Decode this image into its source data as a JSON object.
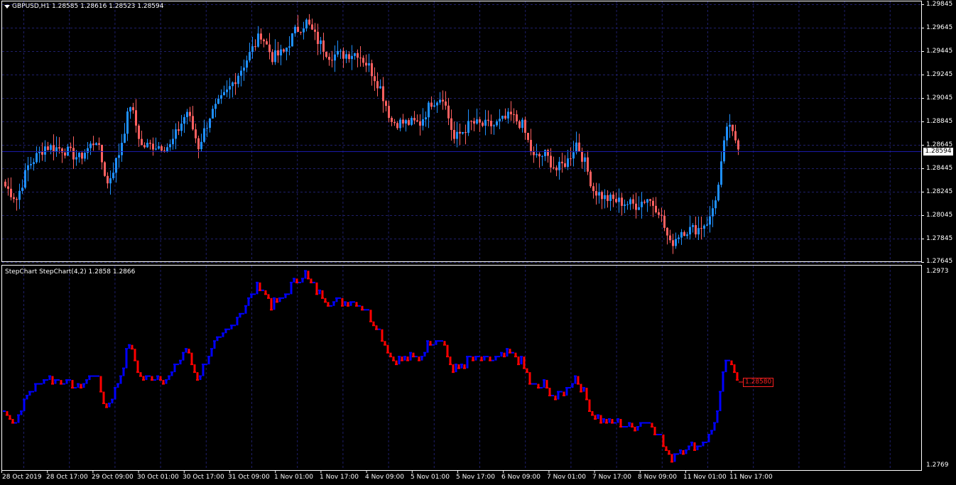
{
  "main_chart": {
    "symbol_info": "GBPUSD,H1  1.28585 1.28616 1.28523 1.28594",
    "price_ticks": [
      "1.29845",
      "1.29645",
      "1.29445",
      "1.29245",
      "1.29045",
      "1.28845",
      "1.28645",
      "1.28445",
      "1.28245",
      "1.28045",
      "1.27845",
      "1.27645"
    ],
    "current_price": "1.28594",
    "bull_color": "#1e90ff",
    "bear_color": "#ff6060"
  },
  "indicator": {
    "label": "StepChart StepChart(4,2) 1.2858 1.2866",
    "price_ticks": [
      "1.2973",
      "1.2769"
    ],
    "last_value_label": "1.28580",
    "up_color": "#0000ff",
    "down_color": "#ff0000"
  },
  "time_axis": {
    "labels": [
      "28 Oct 2019",
      "28 Oct 17:00",
      "29 Oct 09:00",
      "30 Oct 01:00",
      "30 Oct 17:00",
      "31 Oct 09:00",
      "1 Nov 01:00",
      "1 Nov 17:00",
      "4 Nov 09:00",
      "5 Nov 01:00",
      "5 Nov 17:00",
      "6 Nov 09:00",
      "7 Nov 01:00",
      "7 Nov 17:00",
      "8 Nov 09:00",
      "11 Nov 01:00",
      "11 Nov 17:00"
    ]
  },
  "chart_data": {
    "type": "candlestick",
    "symbol": "GBPUSD",
    "timeframe": "H1",
    "ylim": [
      1.2764,
      1.2985
    ],
    "grid": true,
    "close_path_keypoints": [
      [
        0,
        1.2828
      ],
      [
        4,
        1.2817
      ],
      [
        8,
        1.2845
      ],
      [
        14,
        1.2862
      ],
      [
        20,
        1.286
      ],
      [
        26,
        1.2852
      ],
      [
        32,
        1.2868
      ],
      [
        36,
        1.283
      ],
      [
        40,
        1.2856
      ],
      [
        44,
        1.2898
      ],
      [
        48,
        1.2862
      ],
      [
        52,
        1.2863
      ],
      [
        58,
        1.2862
      ],
      [
        64,
        1.2892
      ],
      [
        68,
        1.2862
      ],
      [
        72,
        1.2888
      ],
      [
        78,
        1.2908
      ],
      [
        84,
        1.2932
      ],
      [
        90,
        1.2958
      ],
      [
        94,
        1.2938
      ],
      [
        98,
        1.2942
      ],
      [
        102,
        1.296
      ],
      [
        106,
        1.2968
      ],
      [
        110,
        1.2952
      ],
      [
        114,
        1.294
      ],
      [
        118,
        1.294
      ],
      [
        124,
        1.2942
      ],
      [
        128,
        1.293
      ],
      [
        132,
        1.2912
      ],
      [
        136,
        1.2883
      ],
      [
        140,
        1.2882
      ],
      [
        146,
        1.2882
      ],
      [
        150,
        1.29
      ],
      [
        154,
        1.2905
      ],
      [
        158,
        1.2868
      ],
      [
        164,
        1.2882
      ],
      [
        168,
        1.288
      ],
      [
        172,
        1.288
      ],
      [
        178,
        1.2888
      ],
      [
        182,
        1.288
      ],
      [
        186,
        1.2852
      ],
      [
        190,
        1.2855
      ],
      [
        194,
        1.2842
      ],
      [
        198,
        1.285
      ],
      [
        201,
        1.2865
      ],
      [
        204,
        1.2848
      ],
      [
        207,
        1.2825
      ],
      [
        211,
        1.2818
      ],
      [
        216,
        1.2815
      ],
      [
        222,
        1.2812
      ],
      [
        226,
        1.2818
      ],
      [
        230,
        1.2808
      ],
      [
        234,
        1.2778
      ],
      [
        238,
        1.279
      ],
      [
        244,
        1.2792
      ],
      [
        248,
        1.28
      ],
      [
        251,
        1.2828
      ],
      [
        254,
        1.288
      ],
      [
        257,
        1.2868
      ],
      [
        258,
        1.2858
      ]
    ]
  }
}
